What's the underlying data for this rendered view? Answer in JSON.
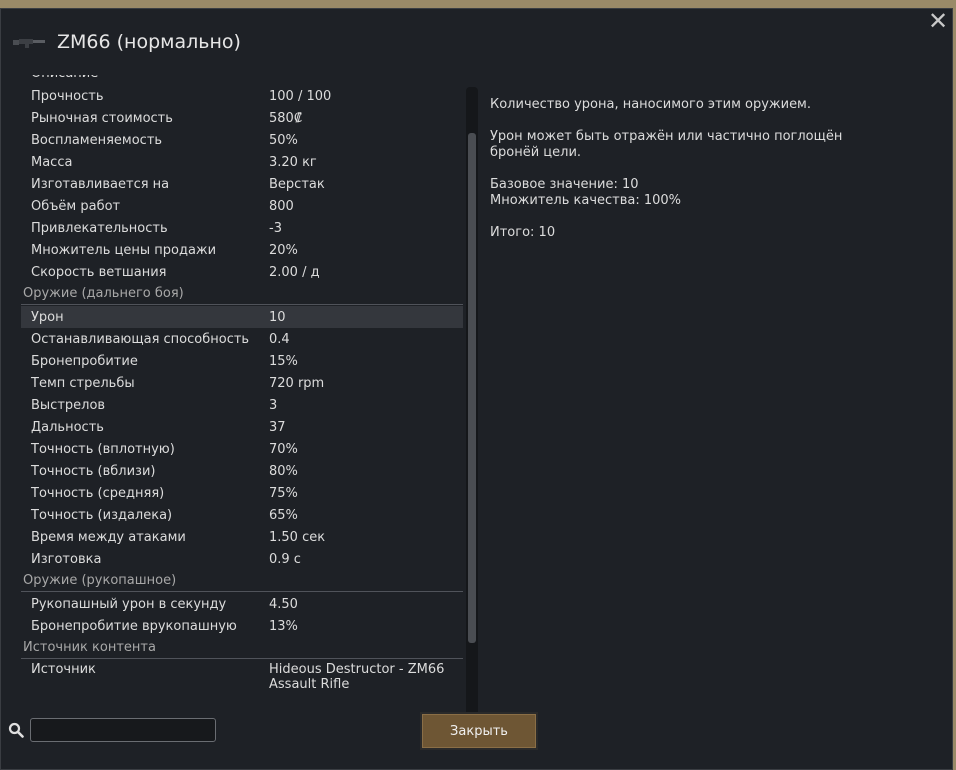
{
  "window": {
    "title": "ZM66 (нормально)",
    "close_glyph": "✕"
  },
  "stats": {
    "partial_label": "Описание",
    "general": [
      {
        "label": "Прочность",
        "value": "100 / 100"
      },
      {
        "label": "Рыночная стоимость",
        "value": "580₡"
      },
      {
        "label": "Воспламеняемость",
        "value": "50%"
      },
      {
        "label": "Масса",
        "value": "3.20 кг"
      },
      {
        "label": "Изготавливается на",
        "value": "Верстак"
      },
      {
        "label": "Объём работ",
        "value": "800"
      },
      {
        "label": "Привлекательность",
        "value": "-3"
      },
      {
        "label": "Множитель цены продажи",
        "value": "20%"
      },
      {
        "label": "Скорость ветшания",
        "value": "2.00 / д"
      }
    ],
    "ranged_header": "Оружие (дальнего боя)",
    "ranged": [
      {
        "label": "Урон",
        "value": "10"
      },
      {
        "label": "Останавливающая способность",
        "value": "0.4"
      },
      {
        "label": "Бронепробитие",
        "value": "15%"
      },
      {
        "label": "Темп стрельбы",
        "value": "720 rpm"
      },
      {
        "label": "Выстрелов",
        "value": "3"
      },
      {
        "label": "Дальность",
        "value": "37"
      },
      {
        "label": "Точность (вплотную)",
        "value": "70%"
      },
      {
        "label": "Точность (вблизи)",
        "value": "80%"
      },
      {
        "label": "Точность (средняя)",
        "value": "75%"
      },
      {
        "label": "Точность (издалека)",
        "value": "65%"
      },
      {
        "label": "Время между атаками",
        "value": "1.50 сек"
      },
      {
        "label": "Изготовка",
        "value": "0.9 с"
      }
    ],
    "melee_header": "Оружие (рукопашное)",
    "melee": [
      {
        "label": "Рукопашный урон в секунду",
        "value": "4.50"
      },
      {
        "label": "Бронепробитие врукопашную",
        "value": "13%"
      }
    ],
    "source_header": "Источник контента",
    "source": {
      "label": "Источник",
      "value": "Hideous Destructor - ZM66 Assault Rifle"
    }
  },
  "description": {
    "line1": "Количество урона, наносимого этим оружием.",
    "line2": "Урон может быть отражён или частично поглощён бронёй цели.",
    "base": "Базовое значение: 10",
    "quality": "Множитель качества: 100%",
    "total": "Итого: 10"
  },
  "search": {
    "value": "",
    "placeholder": ""
  },
  "close_button": {
    "label": "Закрыть"
  },
  "colors": {
    "window_bg": "#1e2126",
    "highlight_row": "#34373d",
    "button_bg": "#6e5634",
    "backdrop": "#9a8a68"
  },
  "icons": {
    "weapon": "rifle-icon",
    "search": "magnifier-icon",
    "close": "close-icon"
  }
}
